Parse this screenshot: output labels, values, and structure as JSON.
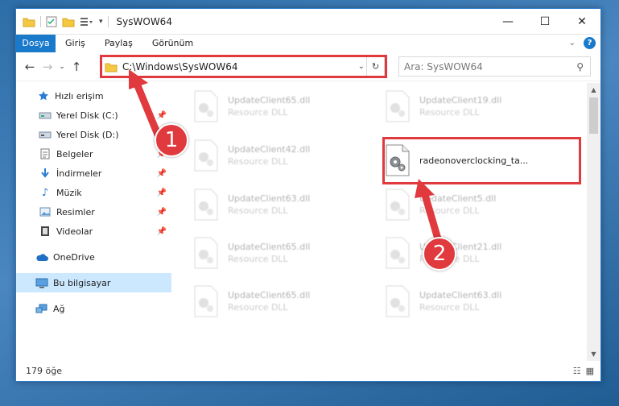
{
  "window": {
    "title": "SysWOW64"
  },
  "ribbon": {
    "tabs": [
      "Dosya",
      "Giriş",
      "Paylaş",
      "Görünüm"
    ],
    "help": "?"
  },
  "address": {
    "path": "C:\\Windows\\SysWOW64"
  },
  "search": {
    "placeholder": "Ara: SysWOW64"
  },
  "sidebar": {
    "items": [
      {
        "label": "Hızlı erişim",
        "icon": "star-icon"
      },
      {
        "label": "Yerel Disk (C:)",
        "icon": "drive-icon"
      },
      {
        "label": "Yerel Disk (D:)",
        "icon": "drive-icon"
      },
      {
        "label": "Belgeler",
        "icon": "documents-icon"
      },
      {
        "label": "İndirmeler",
        "icon": "download-icon"
      },
      {
        "label": "Müzik",
        "icon": "music-icon"
      },
      {
        "label": "Resimler",
        "icon": "pictures-icon"
      },
      {
        "label": "Videolar",
        "icon": "video-icon"
      },
      {
        "label": "OneDrive",
        "icon": "cloud-icon"
      },
      {
        "label": "Bu bilgisayar",
        "icon": "computer-icon"
      },
      {
        "label": "Ağ",
        "icon": "network-icon"
      }
    ]
  },
  "files": [
    {
      "name": "UpdateClient65.dll",
      "type": "Resource DLL"
    },
    {
      "name": "UpdateClient19.dll",
      "type": "Resource DLL"
    },
    {
      "name": "UpdateClient42.dll",
      "type": "Resource DLL"
    },
    {
      "name": "radeonoverclocking_ta...",
      "type": ""
    },
    {
      "name": "UpdateClient63.dll",
      "type": "Resource DLL"
    },
    {
      "name": "UpdateClient5.dll",
      "type": "Resource DLL"
    },
    {
      "name": "UpdateClient65.dll",
      "type": "Resource DLL"
    },
    {
      "name": "UpdateClient21.dll",
      "type": "Resource DLL"
    },
    {
      "name": "UpdateClient65.dll",
      "type": "Resource DLL"
    },
    {
      "name": "UpdateClient63.dll",
      "type": "Resource DLL"
    }
  ],
  "status": {
    "count": "179 öğe"
  },
  "annotations": {
    "step1": "1",
    "step2": "2"
  },
  "colors": {
    "accent": "#1979ca",
    "highlight": "#e0393e"
  }
}
